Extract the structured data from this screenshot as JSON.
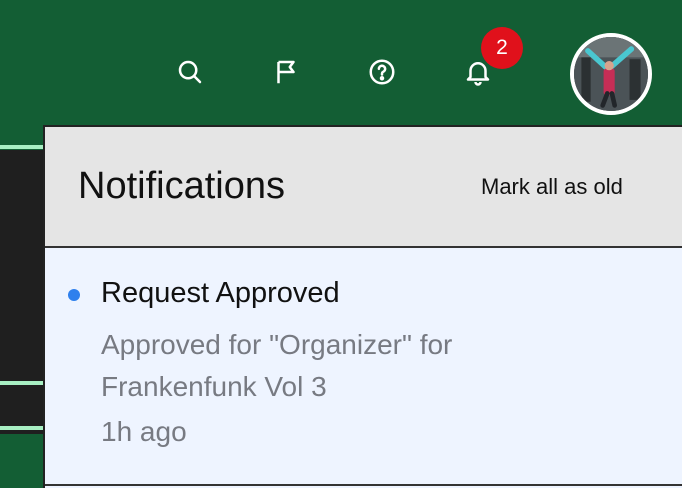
{
  "header": {
    "icons": [
      "search-icon",
      "flag-icon",
      "help-icon",
      "bell-icon"
    ],
    "notification_count": "2"
  },
  "notifications_panel": {
    "title": "Notifications",
    "mark_all_label": "Mark all as old",
    "items": [
      {
        "title": "Request Approved",
        "body": "Approved for \"Organizer\" for Frankenfunk Vol 3",
        "time": "1h ago",
        "unread": true
      }
    ]
  },
  "colors": {
    "header_bg": "#135e34",
    "badge": "#e0111b",
    "unread_dot": "#2f80ed",
    "panel_bg": "#eef4ff"
  }
}
